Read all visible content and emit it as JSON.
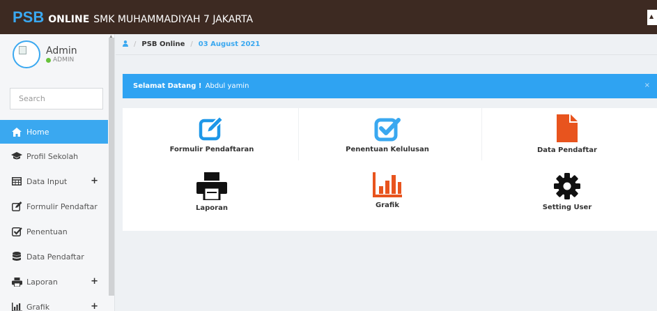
{
  "header": {
    "brand_psb": "PSB",
    "brand_online": "ONLINE",
    "brand_school": "SMK MUHAMMADIYAH 7 JAKARTA"
  },
  "user": {
    "name": "Admin",
    "role": "ADMIN"
  },
  "search": {
    "placeholder": "Search"
  },
  "sidebar": {
    "items": [
      {
        "label": "Home",
        "icon": "home-icon",
        "active": true
      },
      {
        "label": "Profil Sekolah",
        "icon": "graduation-cap-icon"
      },
      {
        "label": "Data Input",
        "icon": "table-icon",
        "expandable": true
      },
      {
        "label": "Formulir Pendaftar",
        "icon": "edit-icon"
      },
      {
        "label": "Penentuan",
        "icon": "check-square-icon"
      },
      {
        "label": "Data Pendaftar",
        "icon": "database-icon"
      },
      {
        "label": "Laporan",
        "icon": "print-icon",
        "expandable": true
      },
      {
        "label": "Grafik",
        "icon": "bar-chart-icon",
        "expandable": true
      }
    ]
  },
  "breadcrumb": {
    "main": "PSB Online",
    "date": "03 August 2021"
  },
  "alert": {
    "bold": "Selamat Datang !",
    "text": "Abdul yamin",
    "close": "×"
  },
  "tiles": {
    "formulir": "Formulir Pendaftaran",
    "penentuan": "Penentuan Kelulusan",
    "data_pendaftar": "Data Pendaftar",
    "laporan": "Laporan",
    "grafik": "Grafik",
    "setting_user": "Setting User"
  },
  "colors": {
    "topbar": "#3d2a22",
    "accent": "#3aa8f0",
    "orange": "#e8541e"
  }
}
